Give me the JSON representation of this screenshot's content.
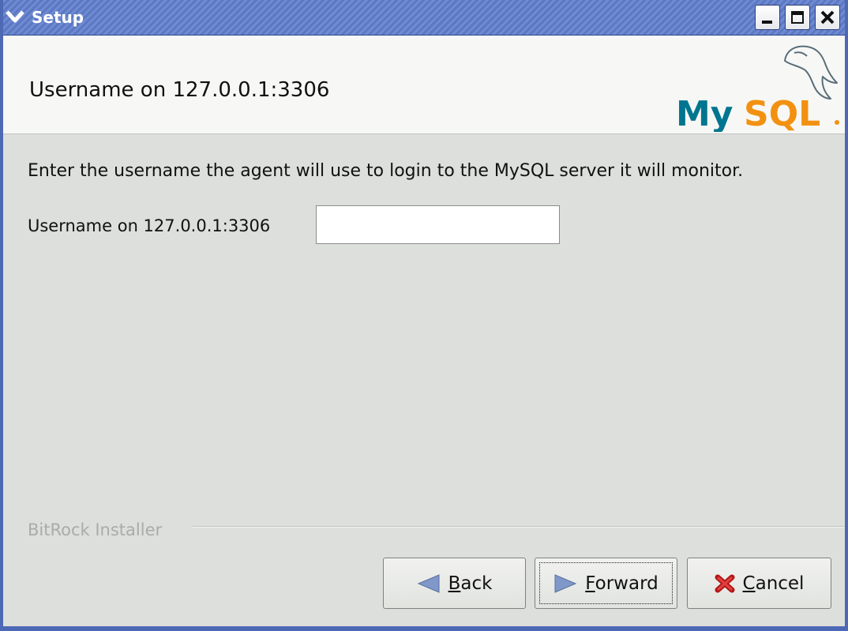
{
  "window": {
    "title": "Setup"
  },
  "header": {
    "title": "Username on 127.0.0.1:3306",
    "logo_text": "MySQL"
  },
  "content": {
    "description": "Enter the username the agent will use to login to the MySQL server it will monitor.",
    "field_label": "Username on 127.0.0.1:3306",
    "field_value": ""
  },
  "footer": {
    "group_label": "BitRock Installer",
    "buttons": {
      "back": {
        "mnemonic": "B",
        "rest": "ack"
      },
      "forward": {
        "mnemonic": "F",
        "rest": "orward"
      },
      "cancel": {
        "mnemonic": "C",
        "rest": "ancel"
      }
    }
  },
  "icons": {
    "menu": "chevron-down-icon",
    "minimize": "minimize-icon",
    "maximize": "maximize-icon",
    "close": "close-icon",
    "back": "arrow-left-icon",
    "forward": "arrow-right-icon",
    "cancel": "cancel-x-icon"
  },
  "colors": {
    "titlebar": "#5c78c2",
    "window_bg": "#dcdfdb",
    "mysql_blue": "#00758f",
    "mysql_orange": "#f29111"
  }
}
